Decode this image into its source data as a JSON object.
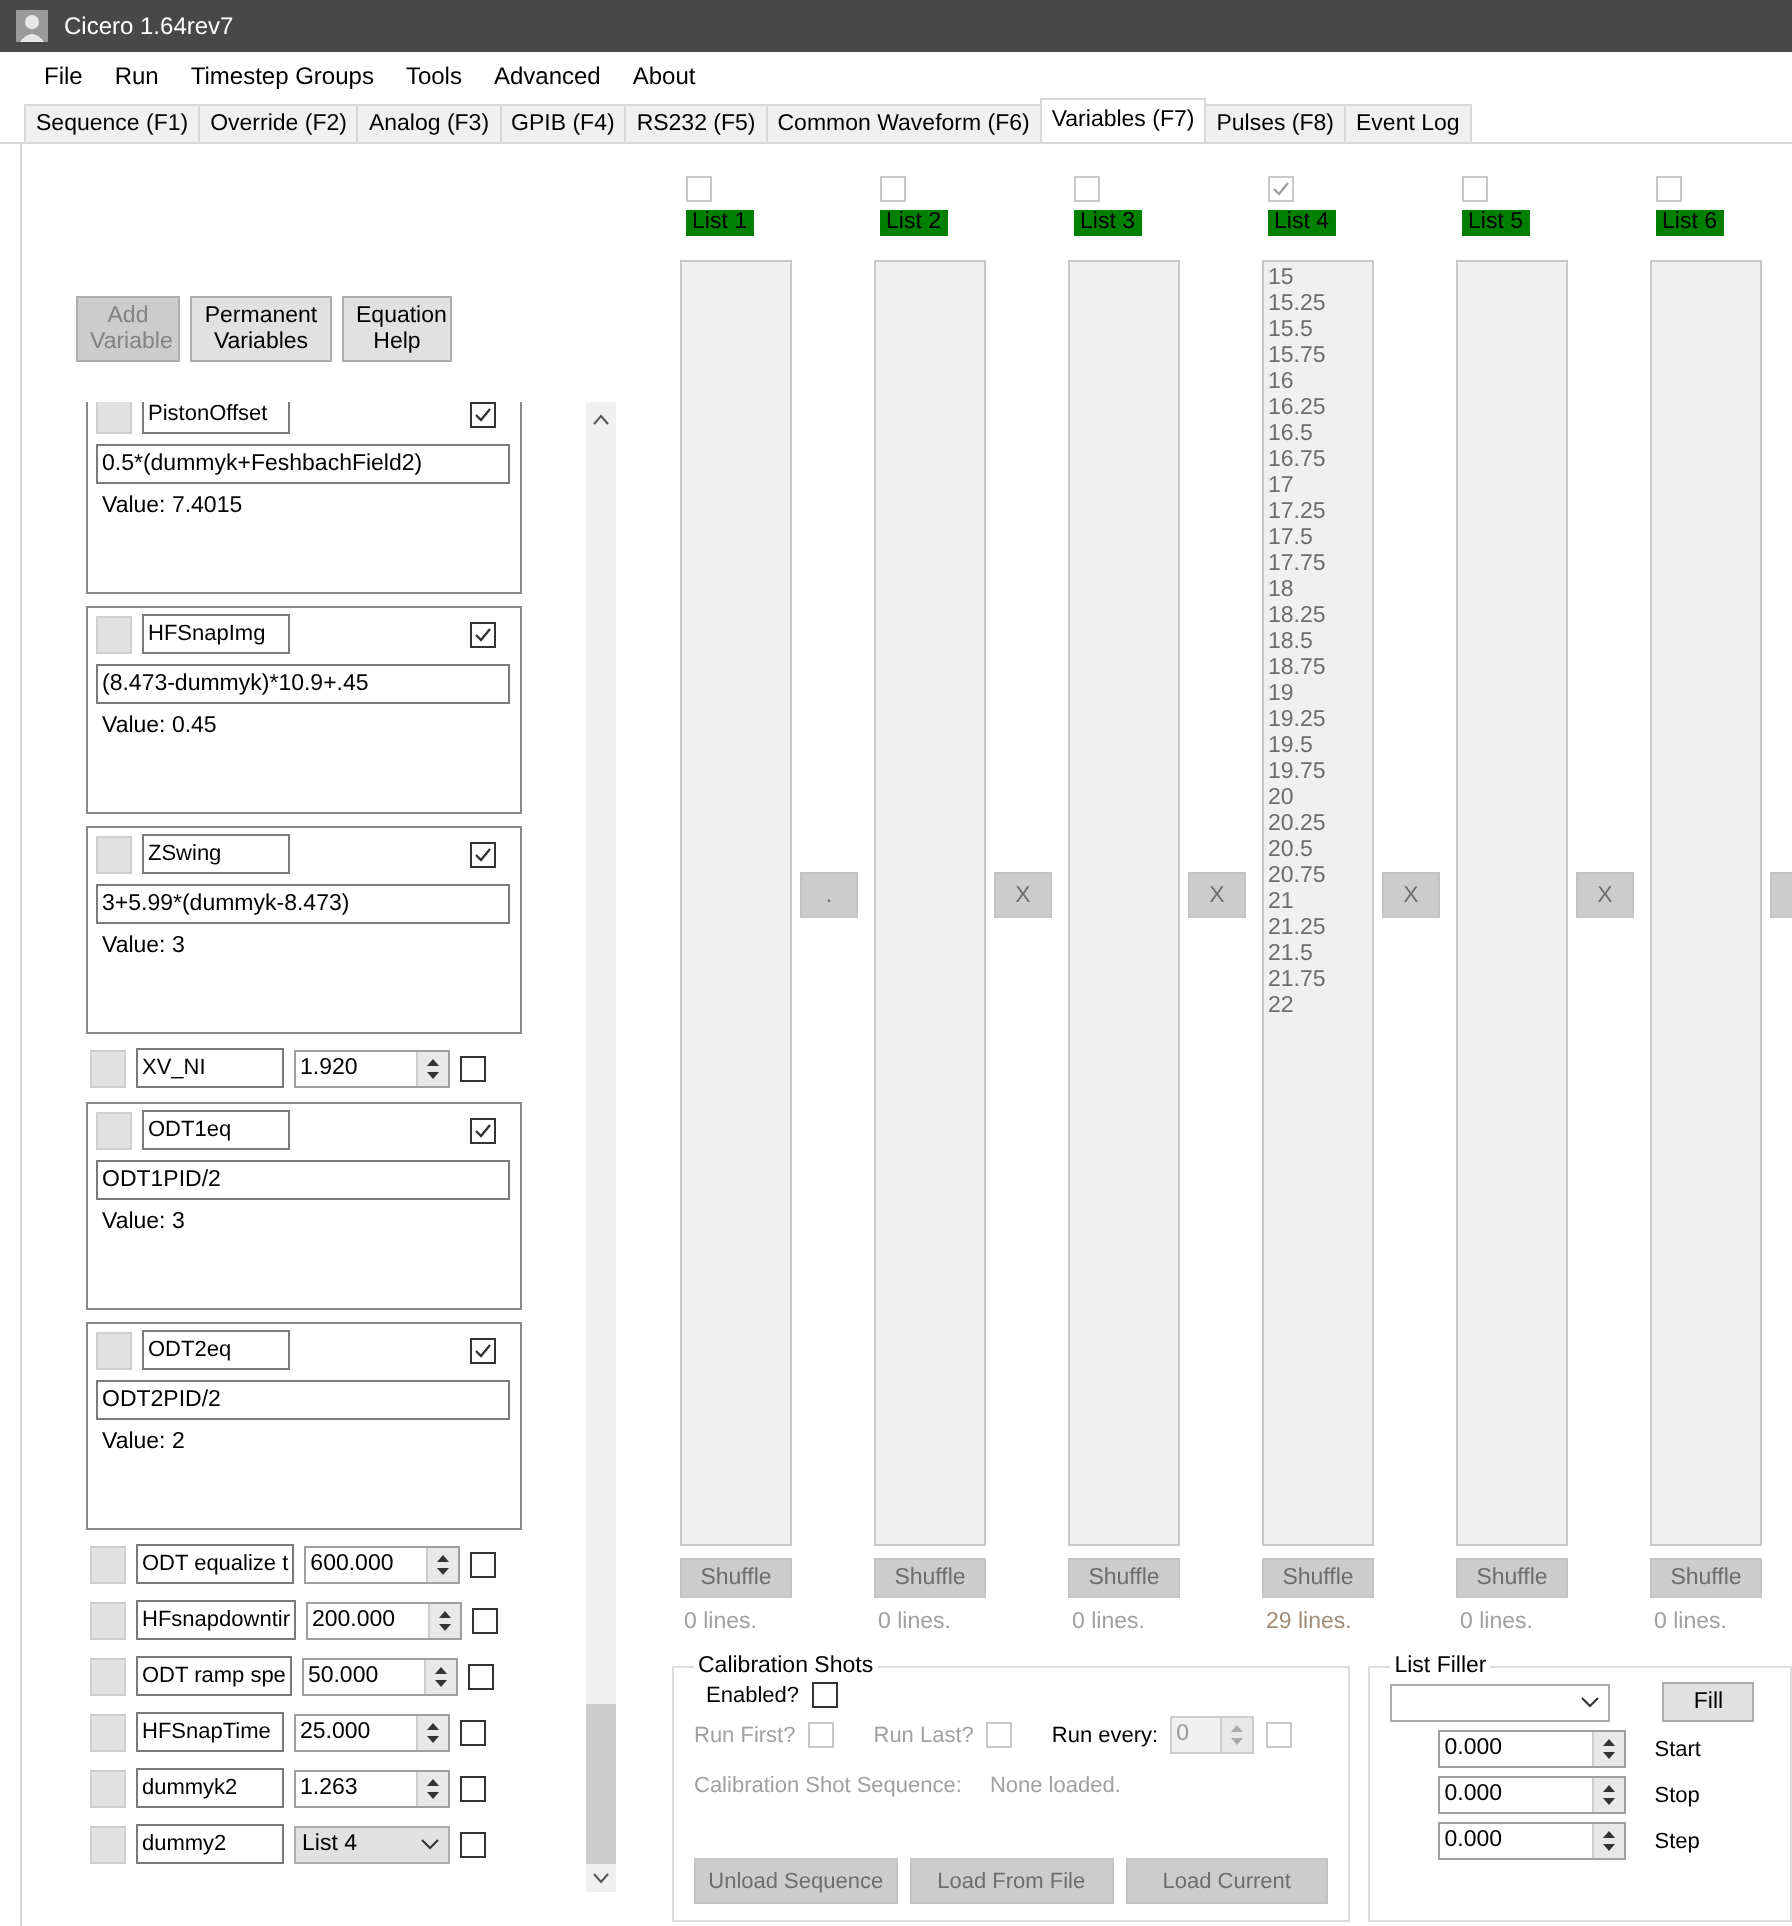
{
  "window": {
    "title": "Cicero 1.64rev7"
  },
  "menu": [
    "File",
    "Run",
    "Timestep Groups",
    "Tools",
    "Advanced",
    "About"
  ],
  "tabs": [
    {
      "label": "Sequence (F1)",
      "selected": false
    },
    {
      "label": "Override (F2)",
      "selected": false
    },
    {
      "label": "Analog (F3)",
      "selected": false
    },
    {
      "label": "GPIB (F4)",
      "selected": false
    },
    {
      "label": "RS232 (F5)",
      "selected": false
    },
    {
      "label": "Common Waveform (F6)",
      "selected": false
    },
    {
      "label": "Variables (F7)",
      "selected": true
    },
    {
      "label": "Pulses (F8)",
      "selected": false
    },
    {
      "label": "Event Log",
      "selected": false
    }
  ],
  "toolbar_buttons": [
    {
      "label": "Add Variable",
      "disabled": true
    },
    {
      "label": "Permanent Variables",
      "disabled": false
    },
    {
      "label": "Equation Help",
      "disabled": false
    }
  ],
  "variables": [
    {
      "kind": "equation",
      "name": "PistonOffset",
      "formula": "0.5*(dummyk+FeshbachField2)",
      "value": "Value: 7.4015",
      "checked": true
    },
    {
      "kind": "equation",
      "name": "HFSnapImg",
      "formula": "(8.473-dummyk)*10.9+.45",
      "value": "Value: 0.45",
      "checked": true
    },
    {
      "kind": "equation",
      "name": "ZSwing",
      "formula": "3+5.99*(dummyk-8.473)",
      "value": "Value: 3",
      "checked": true
    },
    {
      "kind": "number",
      "name": "XV_NI",
      "value": "1.920",
      "checked": false
    },
    {
      "kind": "equation",
      "name": "ODT1eq",
      "formula": "ODT1PID/2",
      "value": "Value: 3",
      "checked": true
    },
    {
      "kind": "equation",
      "name": "ODT2eq",
      "formula": "ODT2PID/2",
      "value": "Value: 2",
      "checked": true
    },
    {
      "kind": "number",
      "name": "ODT equalize t",
      "value": "600.000",
      "checked": false
    },
    {
      "kind": "number",
      "name": "HFsnapdowntir",
      "value": "200.000",
      "checked": false
    },
    {
      "kind": "number",
      "name": "ODT ramp spe",
      "value": "50.000",
      "checked": false
    },
    {
      "kind": "number",
      "name": "HFSnapTime",
      "value": "25.000",
      "checked": false
    },
    {
      "kind": "number",
      "name": "dummyk2",
      "value": "1.263",
      "checked": false
    },
    {
      "kind": "list",
      "name": "dummy2",
      "list": "List 4",
      "checked": false
    }
  ],
  "lists": [
    {
      "label": "List 1",
      "checked": false,
      "lines": "0 lines.",
      "button": ".",
      "shuffle": "Shuffle"
    },
    {
      "label": "List 2",
      "checked": false,
      "lines": "0 lines.",
      "button": "X",
      "shuffle": "Shuffle"
    },
    {
      "label": "List 3",
      "checked": false,
      "lines": "0 lines.",
      "button": "X",
      "shuffle": "Shuffle"
    },
    {
      "label": "List 4",
      "checked": true,
      "lines": "29 lines.",
      "button": "X",
      "shuffle": "Shuffle",
      "items": [
        "15",
        "15.25",
        "15.5",
        "15.75",
        "16",
        "16.25",
        "16.5",
        "16.75",
        "17",
        "17.25",
        "17.5",
        "17.75",
        "18",
        "18.25",
        "18.5",
        "18.75",
        "19",
        "19.25",
        "19.5",
        "19.75",
        "20",
        "20.25",
        "20.5",
        "20.75",
        "21",
        "21.25",
        "21.5",
        "21.75",
        "22"
      ]
    },
    {
      "label": "List 5",
      "checked": false,
      "lines": "0 lines.",
      "button": "X",
      "shuffle": "Shuffle"
    },
    {
      "label": "List 6",
      "checked": false,
      "lines": "0 lines.",
      "shuffle": "Shuffle"
    }
  ],
  "calibration": {
    "title": "Calibration Shots",
    "enabled": {
      "label": "Enabled?",
      "checked": false
    },
    "run_first": {
      "label": "Run First?",
      "checked": false
    },
    "run_last": {
      "label": "Run Last?",
      "checked": false
    },
    "run_every": {
      "label": "Run every:",
      "value": "0",
      "checked": false
    },
    "sequence_label": "Calibration Shot Sequence:",
    "sequence_value": "None loaded.",
    "buttons": [
      "Unload Sequence",
      "Load From File",
      "Load Current"
    ]
  },
  "list_filler": {
    "title": "List Filler",
    "fill_button": "Fill",
    "fields": [
      {
        "value": "0.000",
        "label": "Start"
      },
      {
        "value": "0.000",
        "label": "Stop"
      },
      {
        "value": "0.000",
        "label": "Step"
      }
    ]
  }
}
